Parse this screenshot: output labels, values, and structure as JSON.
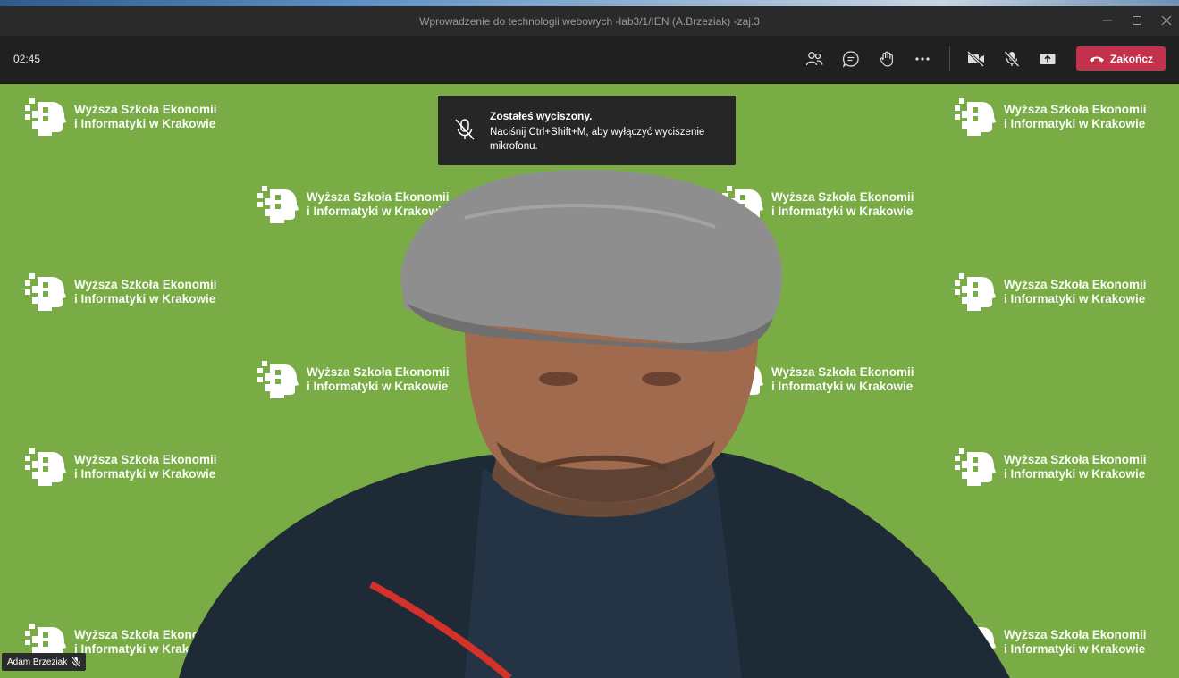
{
  "window": {
    "title": "Wprowadzenie do technologii webowych -lab3/1/IEN (A.Brzeziak) -zaj.3"
  },
  "toolbar": {
    "timer": "02:45",
    "end_call_label": "Zakończ",
    "buttons": [
      "participants-icon",
      "chat-icon",
      "raise-hand-icon",
      "more-icon",
      "camera-off-icon",
      "mic-off-icon",
      "share-screen-icon"
    ],
    "end_color": "#c4314b"
  },
  "background": {
    "color": "#79ac45",
    "logo_line1": "Wyższa Szkoła Ekonomii",
    "logo_line2": "i Informatyki w Krakowie"
  },
  "toast": {
    "title": "Zostałeś wyciszony.",
    "body": "Naciśnij Ctrl+Shift+M, aby wyłączyć wyciszenie mikrofonu.",
    "icon": "mic-off-icon"
  },
  "participant": {
    "name": "Adam Brzeziak",
    "muted_icon": "mic-off-icon"
  }
}
